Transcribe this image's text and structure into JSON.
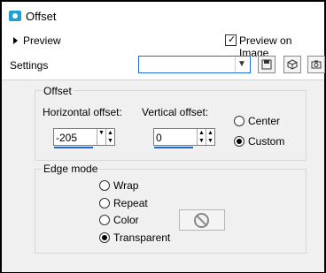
{
  "window": {
    "title": "Offset"
  },
  "top": {
    "preview_label": "Preview",
    "preview_on_image_label": "Preview on Image",
    "preview_on_image_checked": true,
    "settings_label": "Settings",
    "settings_value": ""
  },
  "offset_group": {
    "legend": "Offset",
    "horizontal_label": "Horizontal offset:",
    "horizontal_value": "-205",
    "vertical_label": "Vertical offset:",
    "vertical_value": "0",
    "center_label": "Center",
    "custom_label": "Custom",
    "selected": "Custom"
  },
  "edge_group": {
    "legend": "Edge mode",
    "options": [
      "Wrap",
      "Repeat",
      "Color",
      "Transparent"
    ],
    "selected": "Transparent"
  },
  "icons": {
    "app": "offset-app-icon",
    "expand": "triangle-right-icon",
    "save": "save-icon",
    "presets": "cube-icon",
    "reset": "camera-icon",
    "no_color": "no-symbol-icon"
  }
}
